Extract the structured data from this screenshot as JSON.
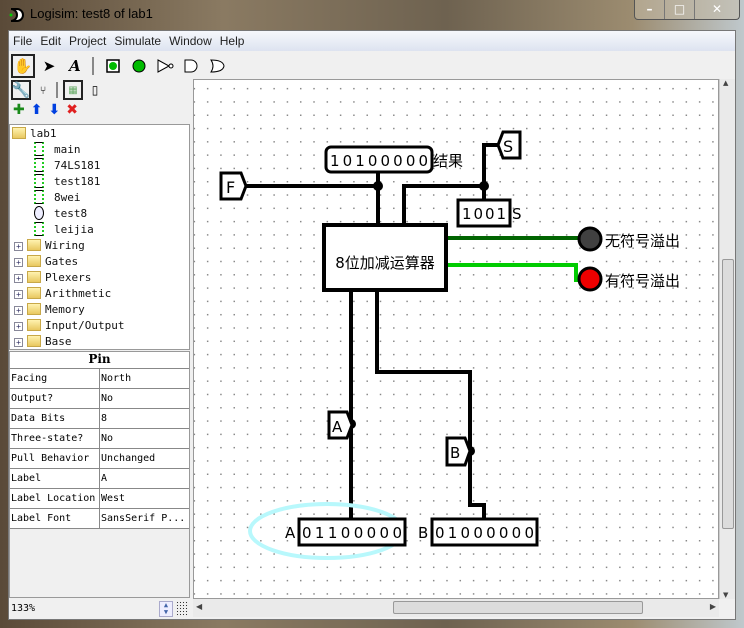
{
  "window": {
    "title": "Logisim: test8 of lab1",
    "minimize": "–",
    "maximize": "□",
    "close": "✕"
  },
  "menu": [
    "File",
    "Edit",
    "Project",
    "Simulate",
    "Window",
    "Help"
  ],
  "toolbar": {
    "tools": [
      "hand-poke-icon",
      "arrow-select-icon",
      "text-tool-icon",
      "input-pin-icon",
      "output-pin-icon",
      "not-gate-icon",
      "and-gate-icon",
      "or-gate-icon"
    ],
    "text_tool": "A"
  },
  "explorer": {
    "root": "lab1",
    "circuits": [
      "main",
      "74LS181",
      "test181",
      "8wei",
      "test8",
      "leijia"
    ],
    "active_circuit": "test8",
    "libraries": [
      "Wiring",
      "Gates",
      "Plexers",
      "Arithmetic",
      "Memory",
      "Input/Output",
      "Base"
    ]
  },
  "properties": {
    "title": "Pin",
    "rows": [
      {
        "name": "Facing",
        "value": "North"
      },
      {
        "name": "Output?",
        "value": "No"
      },
      {
        "name": "Data Bits",
        "value": "8"
      },
      {
        "name": "Three-state?",
        "value": "No"
      },
      {
        "name": "Pull Behavior",
        "value": "Unchanged"
      },
      {
        "name": "Label",
        "value": "A"
      },
      {
        "name": "Label Location",
        "value": "West"
      },
      {
        "name": "Label Font",
        "value": "SansSerif P..."
      }
    ]
  },
  "zoom": "133%",
  "circuit": {
    "tunnel_f": "F",
    "tunnel_s": "S",
    "tunnel_a": "A",
    "tunnel_b": "B",
    "result_value": "10100000",
    "result_label": "结果",
    "s_value": "1001",
    "s_label": "S",
    "alu_label": "8位加减运算器",
    "led_unsigned_label": "无符号溢出",
    "led_signed_label": "有符号溢出",
    "led_unsigned_color": "#404040",
    "led_signed_color": "#ee0000",
    "pin_a_label": "A",
    "pin_a_value": "01100000",
    "pin_b_label": "B",
    "pin_b_value": "01000000",
    "wire_dark": "#006400",
    "wire_bright": "#00cc00",
    "selection_color": "#b8f8fc"
  }
}
